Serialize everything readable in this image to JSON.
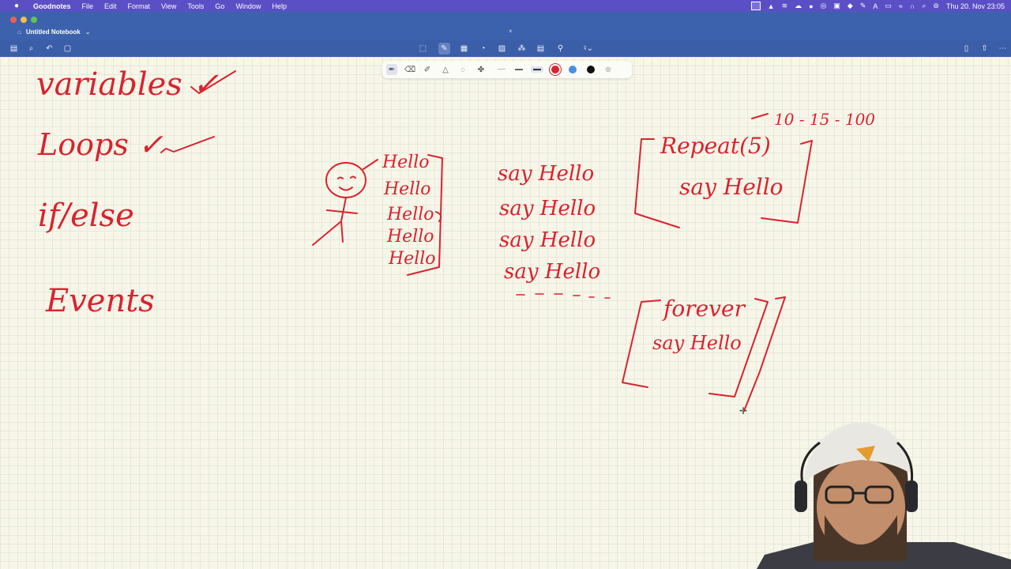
{
  "menubar": {
    "app_name": "Goodnotes",
    "items": [
      "File",
      "Edit",
      "Format",
      "View",
      "Tools",
      "Go",
      "Window",
      "Help"
    ],
    "clock": "Thu 20. Nov 23:05"
  },
  "tab": {
    "title": "Untitled Notebook",
    "chevron": "⌄",
    "close": "×"
  },
  "colors": {
    "ink_red": "#d9232e",
    "pen_blue": "#4a90e2",
    "pen_black": "#111111",
    "menubar": "#5a4fc4",
    "titlebar": "#3d62ad"
  },
  "handwriting": {
    "topics": [
      "variables ✓",
      "Loops ✓",
      "if/else",
      "Events"
    ],
    "hello_list": [
      "Hello",
      "Hello",
      "Hello",
      "Hello",
      "Hello"
    ],
    "say_list": [
      "say Hello",
      "say Hello",
      "say Hello",
      "say Hello"
    ],
    "ellipsis": "- - - - - -",
    "counts": "10 - 15 - 100",
    "repeat_block": {
      "header": "Repeat(5)",
      "body": "say Hello"
    },
    "forever_block": {
      "header": "forever",
      "body": "say Hello"
    }
  }
}
